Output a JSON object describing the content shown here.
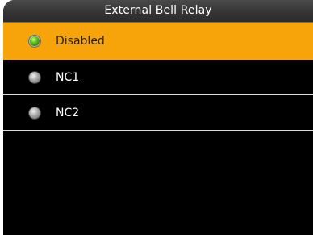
{
  "header": {
    "title": "External Bell Relay"
  },
  "options": [
    {
      "label": "Disabled",
      "selected": true,
      "icon": "radio-selected-icon"
    },
    {
      "label": "NC1",
      "selected": false,
      "icon": "radio-unselected-icon"
    },
    {
      "label": "NC2",
      "selected": false,
      "icon": "radio-unselected-icon"
    }
  ],
  "colors": {
    "selected_background": "#f7a40a",
    "background": "#000000",
    "title_bar": "#353535",
    "separator": "#d9d9d9",
    "radio_selected": "#59c01a"
  }
}
